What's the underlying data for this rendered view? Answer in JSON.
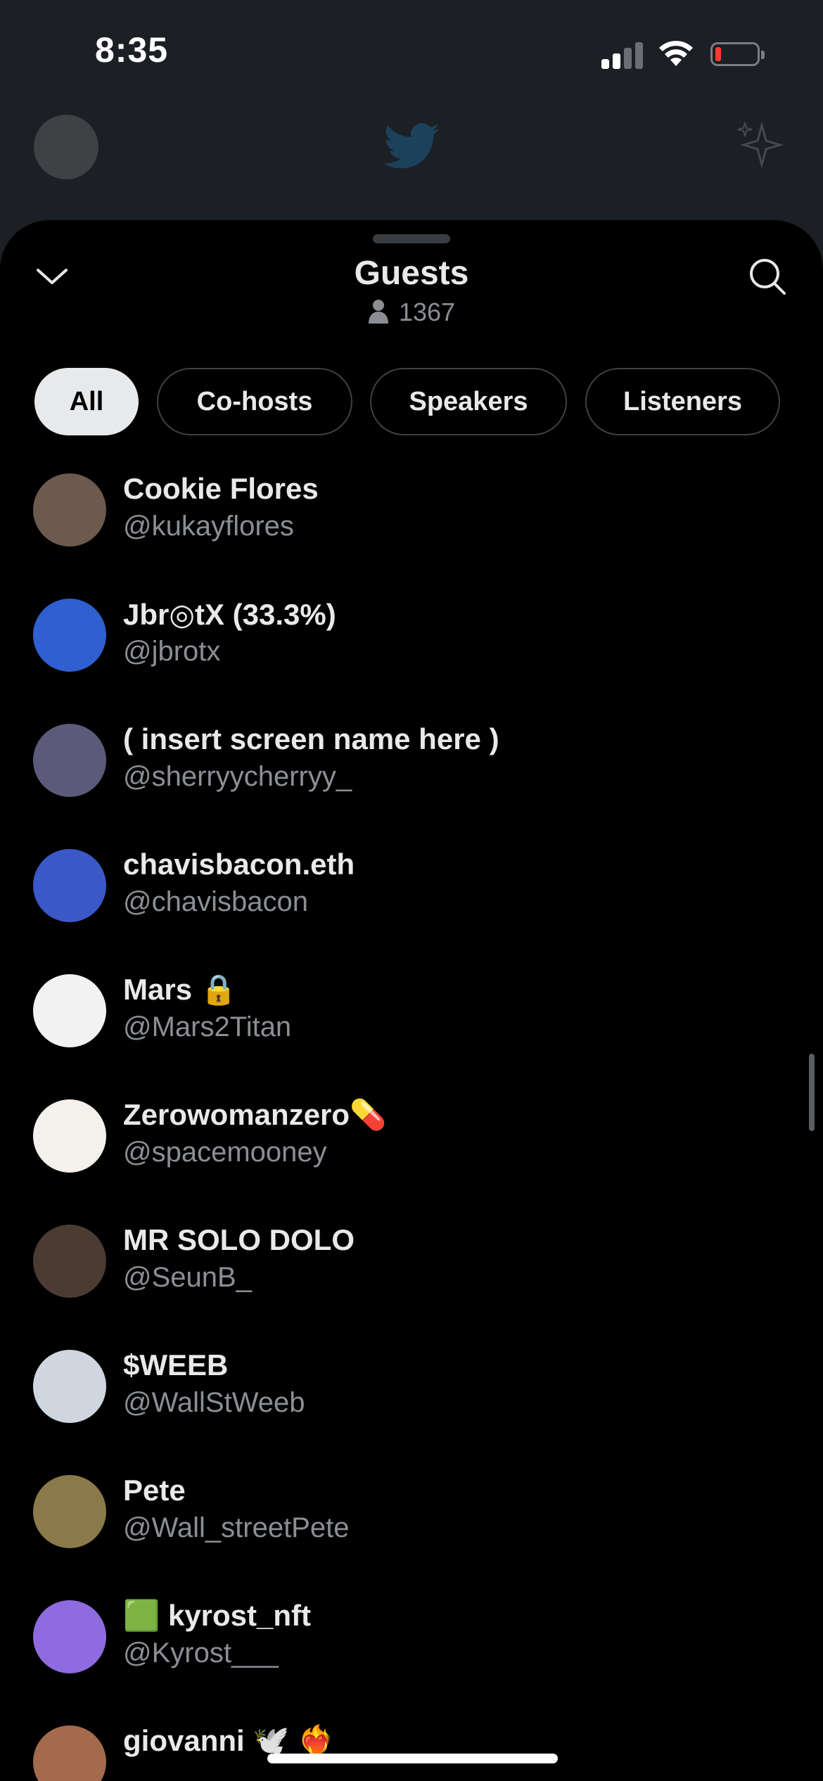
{
  "status_bar": {
    "time": "8:35"
  },
  "sheet": {
    "title": "Guests",
    "count": "1367",
    "filters": [
      {
        "label": "All",
        "active": true
      },
      {
        "label": "Co-hosts",
        "active": false
      },
      {
        "label": "Speakers",
        "active": false
      },
      {
        "label": "Listeners",
        "active": false
      }
    ]
  },
  "guests": [
    {
      "name": "Cookie Flores",
      "handle": "@kukayflores",
      "avatar_color": "#6b5a4d"
    },
    {
      "name": "Jbr◎tX (33.3%)",
      "handle": "@jbrotx",
      "avatar_color": "#2f5fd0"
    },
    {
      "name": "( insert screen name here )",
      "handle": "@sherryycherryy_",
      "avatar_color": "#5c5a7a"
    },
    {
      "name": "chavisbacon.eth",
      "handle": "@chavisbacon",
      "avatar_color": "#3a58c8"
    },
    {
      "name": "Mars 🔒",
      "handle": "@Mars2Titan",
      "avatar_color": "#f2f2f2"
    },
    {
      "name": "Zerowomanzero💊",
      "handle": "@spacemooney",
      "avatar_color": "#f4f1ec"
    },
    {
      "name": "MR SOLO DOLO",
      "handle": "@SeunB_",
      "avatar_color": "#4a3b33"
    },
    {
      "name": "$WEEB",
      "handle": "@WallStWeeb",
      "avatar_color": "#cfd6e0"
    },
    {
      "name": "Pete",
      "handle": "@Wall_streetPete",
      "avatar_color": "#8a7a4a"
    },
    {
      "name": "🟩 kyrost_nft",
      "handle": "@Kyrost___",
      "avatar_color": "#8f6be0"
    },
    {
      "name": "giovanni 🕊️ ❤️‍🔥",
      "handle": "",
      "avatar_color": "#a36a4b"
    }
  ]
}
